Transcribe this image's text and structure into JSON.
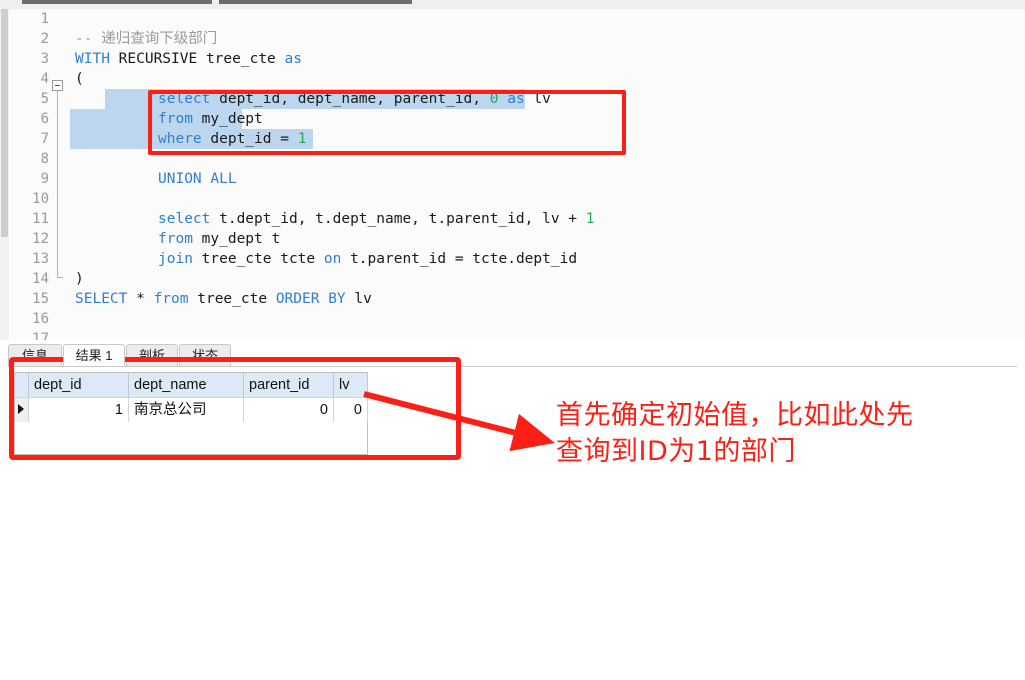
{
  "app": {
    "editor_language": "sql"
  },
  "toolbar": {
    "segments": [
      "toolbar-strip-left",
      "toolbar-strip-right"
    ]
  },
  "editor": {
    "lines": [
      {
        "no": "1",
        "text": ""
      },
      {
        "no": "2",
        "text": "-- 递归查询下级部门"
      },
      {
        "no": "3",
        "text": "WITH RECURSIVE tree_cte as"
      },
      {
        "no": "4",
        "text": "("
      },
      {
        "no": "5",
        "text": "    select dept_id, dept_name, parent_id, 0 as lv"
      },
      {
        "no": "6",
        "text": "    from my_dept"
      },
      {
        "no": "7",
        "text": "    where dept_id = 1"
      },
      {
        "no": "8",
        "text": ""
      },
      {
        "no": "9",
        "text": "    UNION ALL"
      },
      {
        "no": "10",
        "text": ""
      },
      {
        "no": "11",
        "text": "    select t.dept_id, t.dept_name, t.parent_id, lv + 1"
      },
      {
        "no": "12",
        "text": "    from my_dept t"
      },
      {
        "no": "13",
        "text": "    join tree_cte tcte on t.parent_id = tcte.dept_id"
      },
      {
        "no": "14",
        "text": ")"
      },
      {
        "no": "15",
        "text": "SELECT * from tree_cte ORDER BY lv"
      },
      {
        "no": "16",
        "text": ""
      },
      {
        "no": "17",
        "text": ""
      }
    ],
    "fold_marker": "fold-collapse-box"
  },
  "results": {
    "tabs": [
      {
        "id": "info",
        "label": "信息",
        "active": false
      },
      {
        "id": "result",
        "label": "结果 1",
        "active": true
      },
      {
        "id": "profile",
        "label": "剖析",
        "active": false
      },
      {
        "id": "status",
        "label": "状态",
        "active": false
      }
    ],
    "columns": [
      "dept_id",
      "dept_name",
      "parent_id",
      "lv"
    ],
    "rows": [
      {
        "dept_id": "1",
        "dept_name": "南京总公司",
        "parent_id": "0",
        "lv": "0"
      }
    ]
  },
  "annotation": {
    "line1": "首先确定初始值，比如此处先",
    "line2": "查询到ID为1的部门",
    "color": "#fb2015"
  },
  "highlight_color": "#fb2015",
  "selection_color": "#bcd6f0"
}
